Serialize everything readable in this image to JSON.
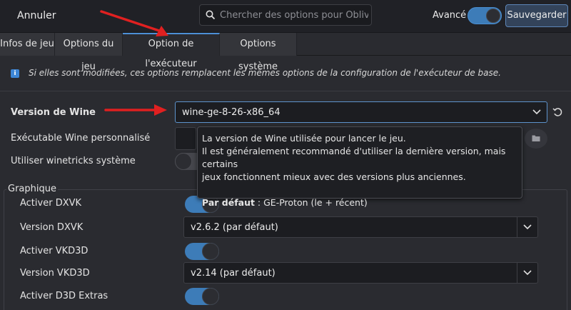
{
  "header": {
    "cancel_label": "Annuler",
    "search_placeholder": "Chercher des options pour Oblivi...",
    "advanced_label": "Avancé",
    "save_label": "Sauvegarder"
  },
  "tabs": [
    {
      "label": "Infos de jeu"
    },
    {
      "label": "Options du jeu"
    },
    {
      "label": "Option de l'exécuteur"
    },
    {
      "label": "Options système"
    }
  ],
  "info": {
    "text": "Si elles sont modifiées, ces options remplacent les mêmes options de la configuration de l'exécuteur de base."
  },
  "options": {
    "wine_version_label": "Version de Wine",
    "wine_version_value": "wine-ge-8-26-x86_64",
    "custom_exe_label": "Exécutable Wine personnalisé",
    "winetricks_label": "Utiliser winetricks système"
  },
  "tooltip": {
    "line1": "La version de Wine utilisée pour lancer le jeu.",
    "line2": "Il est généralement recommandé d'utiliser la dernière version, mais certains",
    "line3": "jeux fonctionnent mieux avec des versions plus anciennes.",
    "default_label": "Par défaut",
    "default_value": " : GE-Proton (le + récent)"
  },
  "graphics": {
    "title": "Graphique",
    "dxvk_enable_label": "Activer DXVK",
    "dxvk_version_label": "Version DXVK",
    "dxvk_version_value": "v2.6.2 (par défaut)",
    "vkd3d_enable_label": "Activer VKD3D",
    "vkd3d_version_label": "Version VKD3D",
    "vkd3d_version_value": "v2.14 (par défaut)",
    "d3d_extras_label": "Activer D3D Extras"
  },
  "colors": {
    "accent": "#3d7cb8",
    "arrow": "#e02020"
  }
}
